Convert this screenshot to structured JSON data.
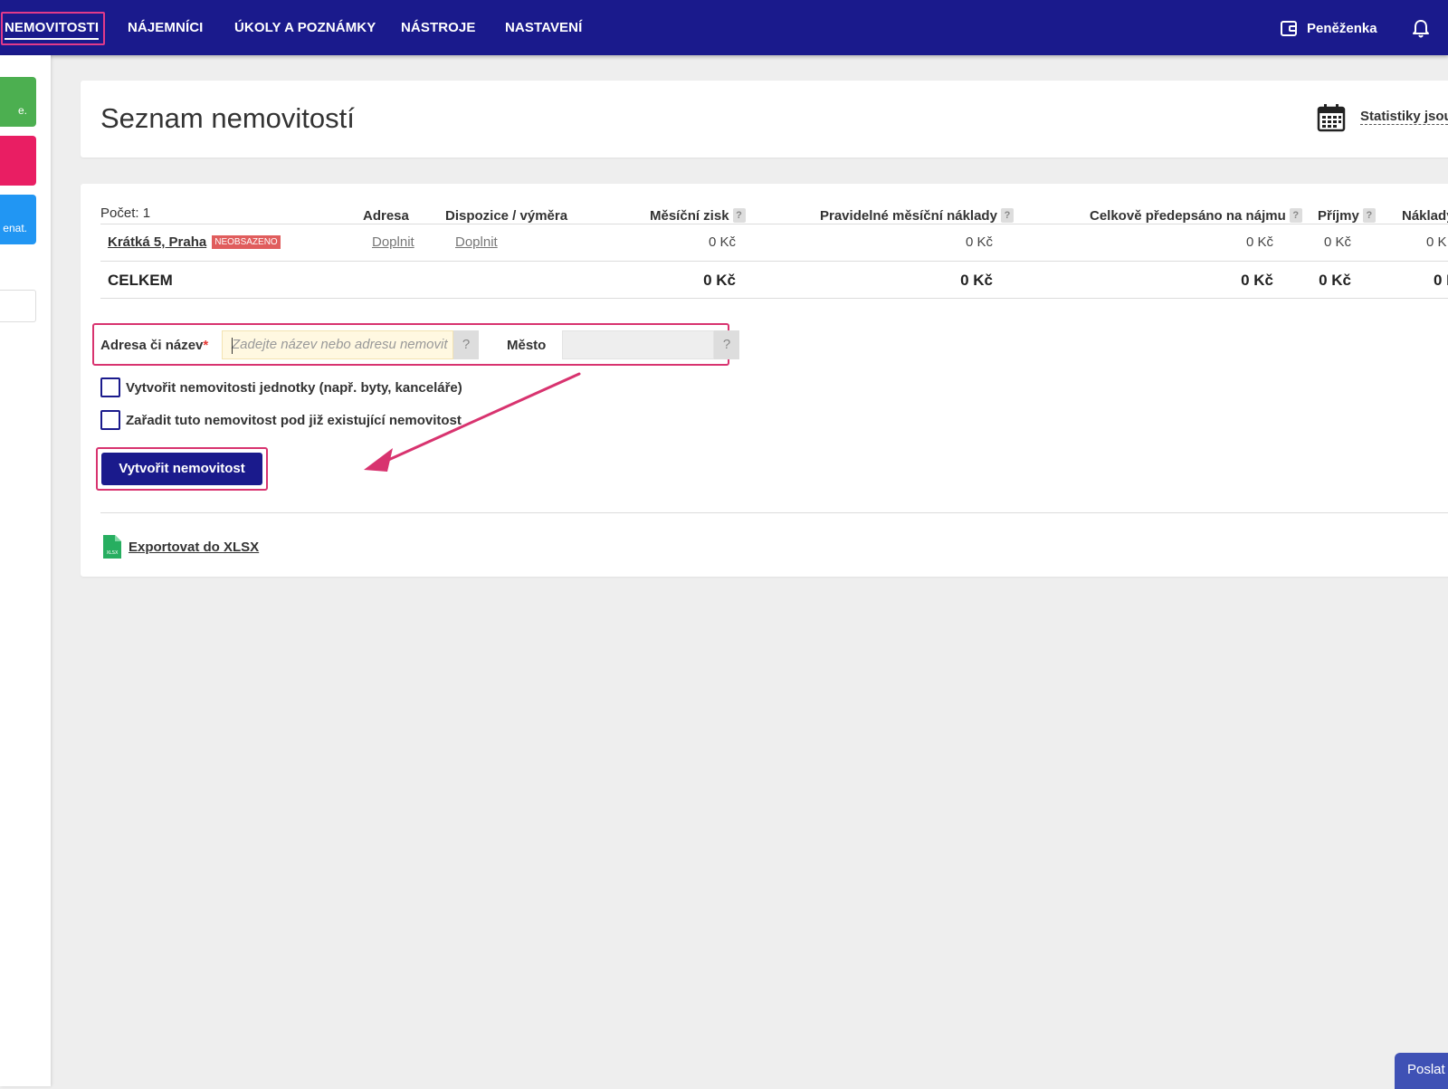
{
  "nav": {
    "items": [
      {
        "label": "NEMOVITOSTI"
      },
      {
        "label": "NÁJEMNÍCI"
      },
      {
        "label": "ÚKOLY A POZNÁMKY"
      },
      {
        "label": "NÁSTROJE"
      },
      {
        "label": "NASTAVENÍ"
      }
    ],
    "wallet_label": "Peněženka"
  },
  "sidebar": {
    "tiles": [
      {
        "label": "e.",
        "color": "#4caf50"
      },
      {
        "label": "",
        "color": "#e91e63"
      },
      {
        "label": "enat.",
        "color": "#2196f3"
      }
    ]
  },
  "header": {
    "title": "Seznam nemovitostí",
    "stats_link": "Statistiky jsou"
  },
  "table": {
    "count": "Počet: 1",
    "columns": {
      "address": "Adresa",
      "disposition": "Dispozice / výměra",
      "monthly_profit": "Měsíční zisk",
      "regular_costs": "Pravidelné měsíční náklady",
      "total_prescribed": "Celkově předepsáno na nájmu",
      "income": "Příjmy",
      "costs": "Náklady"
    },
    "help_glyph": "?",
    "rows": [
      {
        "name": "Krátká 5, Praha",
        "badge": "NEOBSAZENO",
        "address": "Doplnit",
        "disposition": "Doplnit",
        "monthly_profit": "0 Kč",
        "regular_costs": "0 Kč",
        "total_prescribed": "0 Kč",
        "income": "0 Kč",
        "costs": "0 K"
      }
    ],
    "total": {
      "label": "CELKEM",
      "monthly_profit": "0 Kč",
      "regular_costs": "0 Kč",
      "total_prescribed": "0 Kč",
      "income": "0 Kč",
      "costs": "0 K"
    }
  },
  "form": {
    "address_label": "Adresa či název",
    "required_mark": "*",
    "address_placeholder": "Zadejte název nebo adresu nemovit",
    "city_label": "Město",
    "city_value": "",
    "help_glyph": "?",
    "checkbox_units": "Vytvořit nemovitosti jednotky (např. byty, kanceláře)",
    "checkbox_parent": "Zařadit tuto nemovitost pod již existující nemovitost",
    "submit_label": "Vytvořit nemovitost"
  },
  "export": {
    "label": "Exportovat do XLSX",
    "icon_text": "XLSX"
  },
  "footer": {
    "send_label": "Poslat"
  },
  "colors": {
    "topbar": "#1a1a8c",
    "highlight": "#d8336f",
    "badge": "#e05d5d",
    "arrow": "#d8336f"
  }
}
